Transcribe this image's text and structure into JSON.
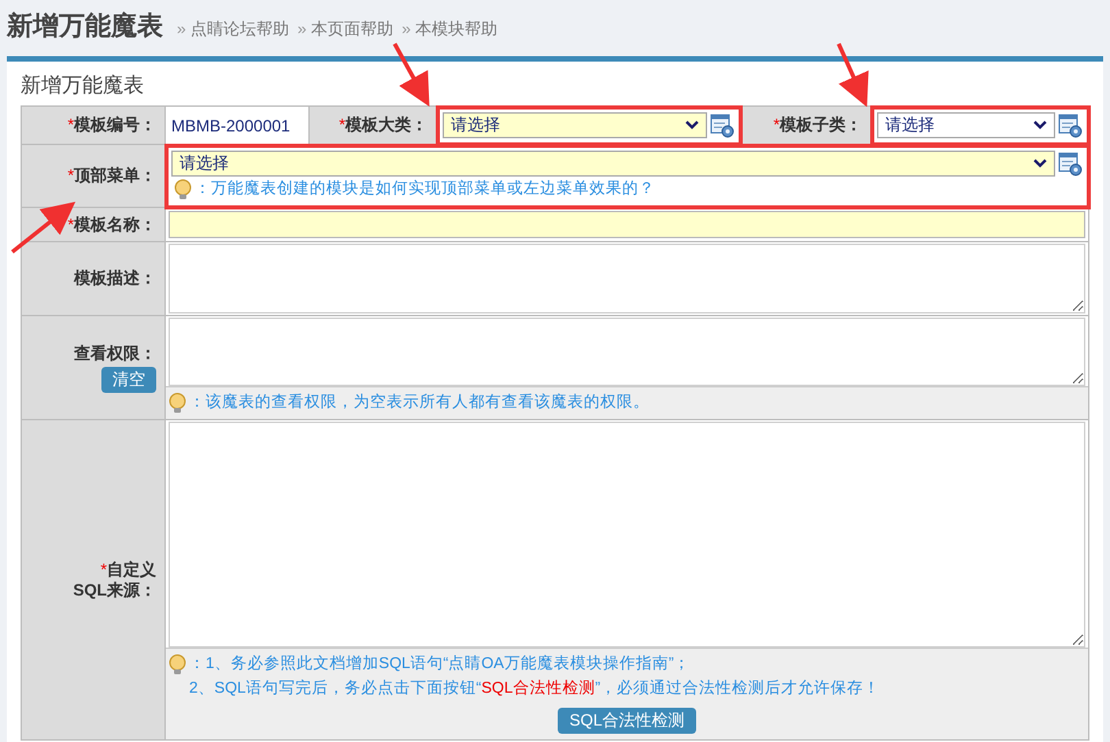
{
  "page_title": "新增万能魔表",
  "help_links": [
    {
      "marker": "»",
      "text": "点睛论坛帮助"
    },
    {
      "marker": "»",
      "text": "本页面帮助"
    },
    {
      "marker": "»",
      "text": "本模块帮助"
    }
  ],
  "panel_title": "新增万能魔表",
  "rows": [
    {
      "fields": [
        {
          "kind": "value",
          "label": "模板编号：",
          "required_mark": "*",
          "value": "MBMB-2000001"
        },
        {
          "kind": "select",
          "label": "模板大类：",
          "required_mark": "*",
          "value": "请选择",
          "tinted": true,
          "highlighted": true
        },
        {
          "kind": "select",
          "label": "模板子类：",
          "required_mark": "*",
          "value": "请选择",
          "tinted": false,
          "highlighted": true
        }
      ]
    },
    {
      "fields": [
        {
          "kind": "select",
          "label": "顶部菜单：",
          "required_mark": "*",
          "value": "请选择",
          "tinted": true,
          "highlighted": true,
          "hint_lines": [
            [
              {
                "text": "：万能魔表创建的模块是如何实现顶部菜单或左边菜单效果的？",
                "emphasis": false
              }
            ]
          ]
        }
      ]
    },
    {
      "fields": [
        {
          "kind": "input",
          "label": "模板名称：",
          "required_mark": "*",
          "tinted": true
        }
      ]
    },
    {
      "fields": [
        {
          "kind": "textarea",
          "label": "模板描述："
        }
      ]
    },
    {
      "fields": [
        {
          "kind": "textarea",
          "label": "查看权限：",
          "label_button": "清空",
          "hint_lines": [
            [
              {
                "text": "：该魔表的查看权限，为空表示所有人都有查看该魔表的权限。",
                "emphasis": false
              }
            ]
          ]
        }
      ]
    },
    {
      "fields": [
        {
          "kind": "sql",
          "label_lines": [
            "自定义",
            "SQL来源："
          ],
          "required_mark": "*",
          "hint_lines": [
            [
              {
                "text": "：1、务必参照此文档增加SQL语句“点睛OA万能魔表模块操作指南”；",
                "emphasis": false
              }
            ],
            [
              {
                "text": "2、SQL语句写完后，务必点击下面按钮“",
                "emphasis": false
              },
              {
                "text": "SQL合法性检测",
                "emphasis": true
              },
              {
                "text": "”，必须通过合法性检测后才允许保存！",
                "emphasis": false
              }
            ]
          ],
          "action_button": "SQL合法性检测"
        }
      ]
    }
  ]
}
